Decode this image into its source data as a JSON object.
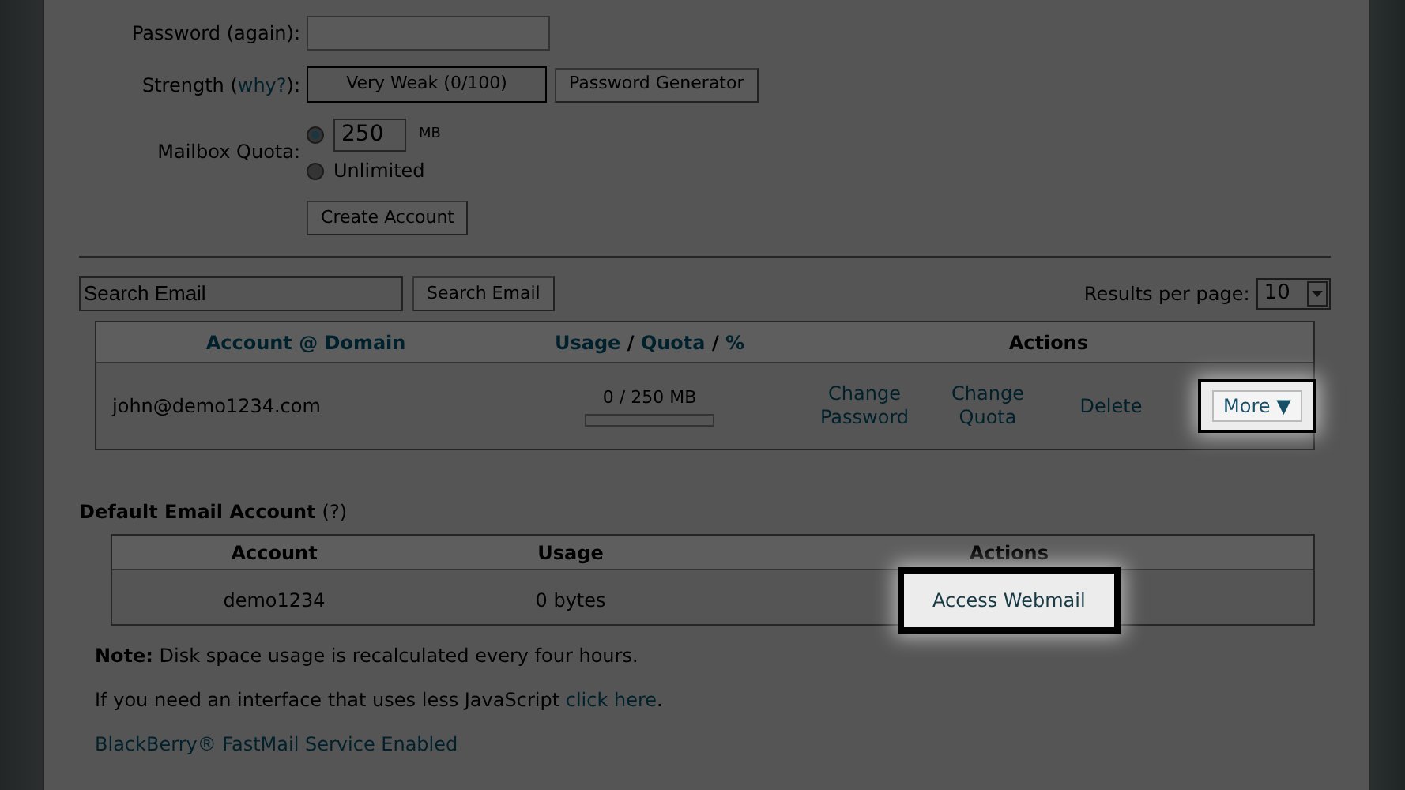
{
  "form": {
    "password_again_label": "Password (again):",
    "strength_before": "Strength (",
    "strength_link": "why?",
    "strength_after": "):",
    "strength_meter": "Very Weak (0/100)",
    "generator_button": "Password Generator",
    "quota_label": "Mailbox Quota:",
    "quota_options": [
      {
        "kind": "input",
        "value": "250",
        "unit": "MB",
        "selected": true
      },
      {
        "kind": "label",
        "label": "Unlimited",
        "selected": false
      }
    ],
    "create_button": "Create Account"
  },
  "search": {
    "value": "Search Email",
    "button": "Search Email",
    "results_label": "Results per page:",
    "results_value": "10"
  },
  "accounts_table": {
    "columns": [
      {
        "parts": [
          {
            "text": "Account @ Domain",
            "link": true
          }
        ]
      },
      {
        "parts": [
          {
            "text": "Usage",
            "link": true
          },
          {
            "text": " / ",
            "link": false
          },
          {
            "text": "Quota",
            "link": true
          },
          {
            "text": " / ",
            "link": false
          },
          {
            "text": "%",
            "link": true
          }
        ]
      },
      {
        "parts": [
          {
            "text": "Actions",
            "link": false
          }
        ]
      }
    ],
    "rows": [
      {
        "account": "john@demo1234.com",
        "usage": "0 / 250 MB",
        "level": 0,
        "actions": [
          "Change Password",
          "Change Quota",
          "Delete"
        ],
        "more_button": "More ▼",
        "highlighted": true
      }
    ]
  },
  "default_account": {
    "title": "Default Email Account",
    "help": "(?)",
    "columns": [
      "Account",
      "Usage",
      "Actions"
    ],
    "rows": [
      {
        "account": "demo1234",
        "usage": "0 bytes",
        "action": "Access Webmail",
        "highlighted": true
      }
    ]
  },
  "note": "**Note:** Disk space usage is recalculated every four hours.",
  "js_note": {
    "text": "If you need an interface that uses less JavaScript ",
    "link": "click here",
    "after": "."
  },
  "blackberry": "BlackBerry® FastMail Service Enabled"
}
